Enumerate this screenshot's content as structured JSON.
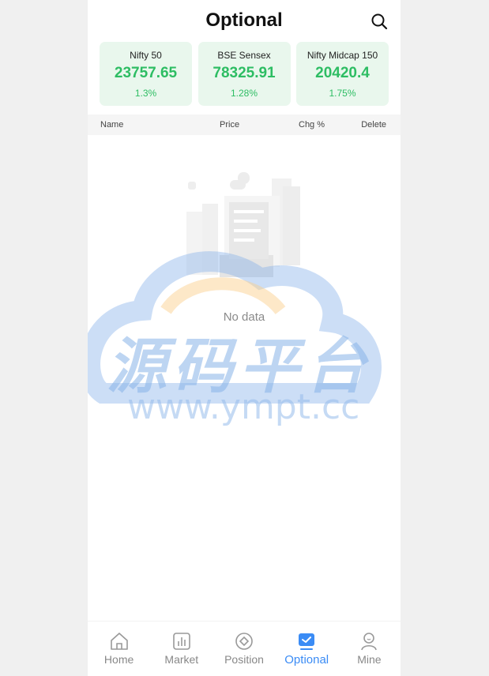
{
  "header": {
    "title": "Optional",
    "search_icon": "search-icon"
  },
  "indices": [
    {
      "name": "Nifty 50",
      "value": "23757.65",
      "change": "1.3%"
    },
    {
      "name": "BSE Sensex",
      "value": "78325.91",
      "change": "1.28%"
    },
    {
      "name": "Nifty Midcap 150",
      "value": "20420.4",
      "change": "1.75%"
    }
  ],
  "table": {
    "columns": {
      "name": "Name",
      "price": "Price",
      "chg": "Chg %",
      "delete": "Delete"
    },
    "empty_text": "No data"
  },
  "watermark": {
    "cn": "源码平台",
    "url": "www.ympt.cc"
  },
  "tabbar": {
    "items": [
      {
        "label": "Home",
        "icon": "home-icon"
      },
      {
        "label": "Market",
        "icon": "market-icon"
      },
      {
        "label": "Position",
        "icon": "position-icon"
      },
      {
        "label": "Optional",
        "icon": "optional-icon",
        "active": true
      },
      {
        "label": "Mine",
        "icon": "mine-icon"
      }
    ]
  },
  "colors": {
    "up": "#2dbd63",
    "card_bg": "#e9f7ed",
    "accent": "#3b8cf5"
  }
}
